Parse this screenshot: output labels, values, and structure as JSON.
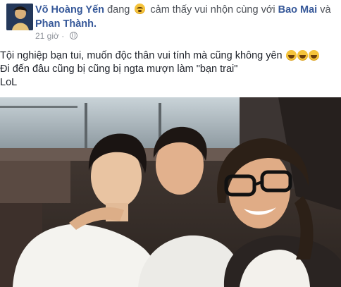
{
  "post": {
    "author": "Võ Hoàng Yến",
    "feeling_prefix": "đang",
    "feeling_text": "cảm thấy vui nhộn cùng với",
    "tag_1": "Bao Mai",
    "conjunction": "và",
    "tag_2": "Phan Thành.",
    "timestamp": "21 giờ",
    "text_line_1": "Tội nghiệp bạn tui, muốn độc thân vui tính mà cũng không yên",
    "text_line_2": "Đi đến đâu cũng bị cũng bị ngta mượn làm \"bạn trai\"",
    "text_line_3": "LoL"
  },
  "icons": {
    "feeling": "feeling-emoji-icon",
    "privacy": "globe-icon",
    "laugh": "laughing-emoji-icon"
  },
  "colors": {
    "link": "#365899",
    "meta": "#90949c",
    "text": "#1d2129"
  }
}
